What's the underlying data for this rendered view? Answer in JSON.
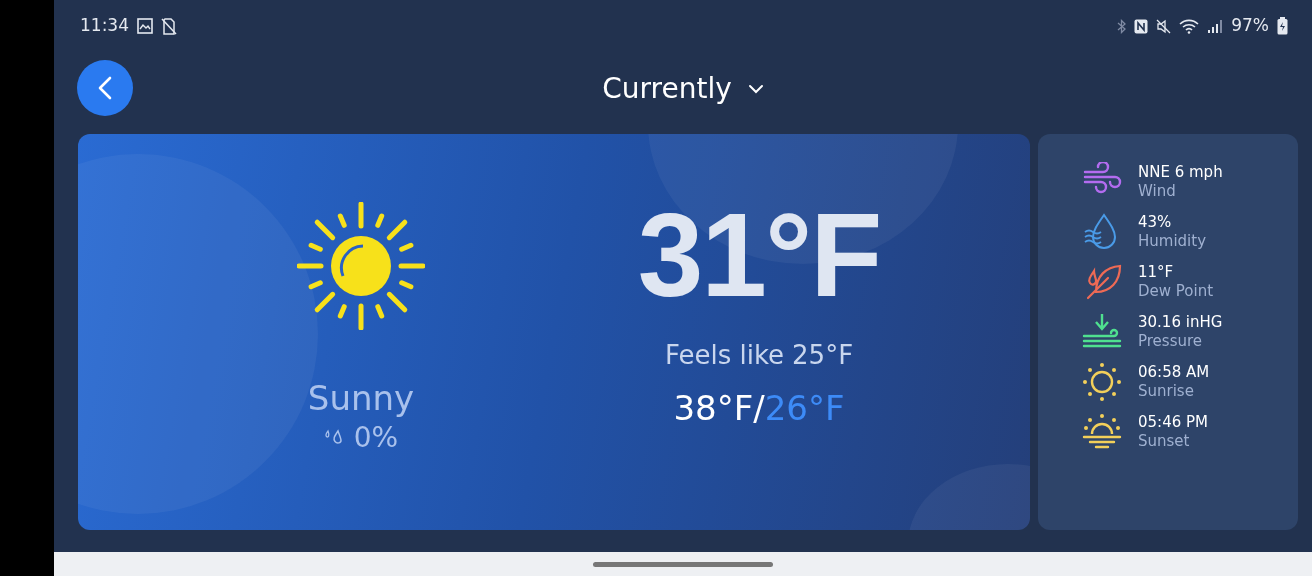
{
  "status_bar": {
    "time": "11:34",
    "battery": "97%"
  },
  "header": {
    "title": "Currently"
  },
  "current": {
    "condition": "Sunny",
    "precipitation": "0%",
    "temperature": "31°F",
    "feels_like_label": "Feels like",
    "feels_like": "25°F",
    "high": "38°F",
    "separator": "/",
    "low": "26°F"
  },
  "details": [
    {
      "kind": "wind",
      "value": "NNE 6 mph",
      "label": "Wind"
    },
    {
      "kind": "humidity",
      "value": "43%",
      "label": "Humidity"
    },
    {
      "kind": "dew_point",
      "value": "11°F",
      "label": "Dew Point"
    },
    {
      "kind": "pressure",
      "value": "30.16 inHG",
      "label": "Pressure"
    },
    {
      "kind": "sunrise",
      "value": "06:58 AM",
      "label": "Sunrise"
    },
    {
      "kind": "sunset",
      "value": "05:46 PM",
      "label": "Sunset"
    }
  ]
}
